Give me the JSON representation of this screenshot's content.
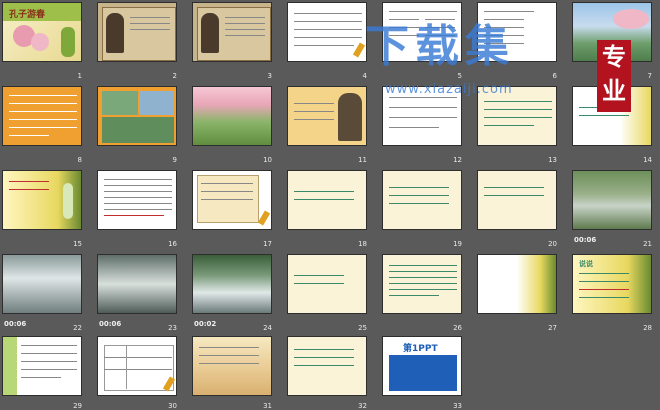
{
  "watermark": {
    "brand": "下载集",
    "url": "www.xiazaiji.com",
    "badge": "专业"
  },
  "slides": [
    {
      "num": "1",
      "title": "孔子游春"
    },
    {
      "num": "2"
    },
    {
      "num": "3"
    },
    {
      "num": "4"
    },
    {
      "num": "5"
    },
    {
      "num": "6"
    },
    {
      "num": "7"
    },
    {
      "num": "8"
    },
    {
      "num": "9"
    },
    {
      "num": "10"
    },
    {
      "num": "11"
    },
    {
      "num": "12"
    },
    {
      "num": "13"
    },
    {
      "num": "14"
    },
    {
      "num": "15"
    },
    {
      "num": "16"
    },
    {
      "num": "17"
    },
    {
      "num": "18"
    },
    {
      "num": "19"
    },
    {
      "num": "20"
    },
    {
      "num": "21",
      "time": "00:06"
    },
    {
      "num": "22",
      "time": "00:06"
    },
    {
      "num": "23",
      "time": "00:06"
    },
    {
      "num": "24",
      "time": "00:02"
    },
    {
      "num": "25"
    },
    {
      "num": "26"
    },
    {
      "num": "27"
    },
    {
      "num": "28",
      "title": "说说"
    },
    {
      "num": "29"
    },
    {
      "num": "30"
    },
    {
      "num": "31"
    },
    {
      "num": "32"
    },
    {
      "num": "33",
      "title": "第1PPT"
    }
  ]
}
